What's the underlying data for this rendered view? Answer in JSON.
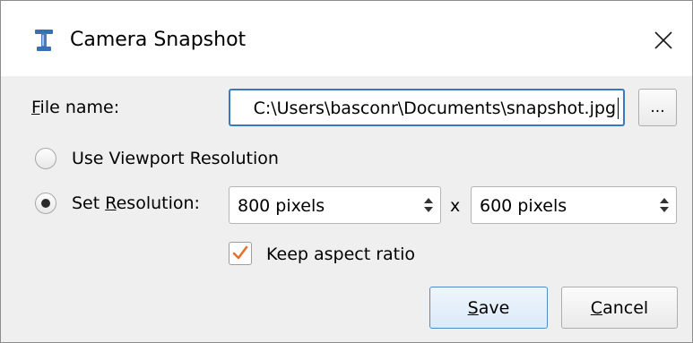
{
  "window": {
    "title": "Camera Snapshot",
    "app_icon": "inkscape-style-app-icon",
    "close_icon": "close-x-icon"
  },
  "file": {
    "label_mnemonic": "F",
    "label_rest": "ile name:",
    "value": "C:\\Users\\basconr\\Documents\\snapshot.jpg",
    "browse_label": "..."
  },
  "resolution": {
    "viewport_option": "Use Viewport Resolution",
    "viewport_selected": false,
    "set_label_prefix": "Set ",
    "set_label_mnemonic": "R",
    "set_label_rest": "esolution:",
    "set_selected": true,
    "width_value": "800 pixels",
    "separator": "x",
    "height_value": "600 pixels",
    "spinner_icon": "up-down-arrows-icon"
  },
  "aspect": {
    "label": "Keep aspect ratio",
    "checked": true,
    "check_color": "#e8702a"
  },
  "buttons": {
    "save_mnemonic": "S",
    "save_rest": "ave",
    "cancel_mnemonic": "C",
    "cancel_rest": "ancel"
  },
  "colors": {
    "focus_border": "#3a78c2",
    "dialog_bg": "#efefef"
  }
}
